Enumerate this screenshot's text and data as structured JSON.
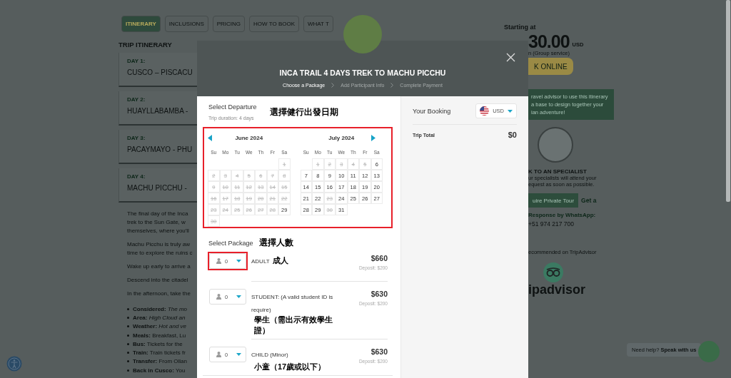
{
  "page": {
    "tabs": [
      {
        "label": "ITINERARY",
        "selected": true
      },
      {
        "label": "INCLUSIONS",
        "selected": false
      },
      {
        "label": "PRICING",
        "selected": false
      },
      {
        "label": "HOW TO BOOK",
        "selected": false
      },
      {
        "label": "WHAT T",
        "selected": false
      }
    ],
    "section_title": "TRIP ITINERARY",
    "days": [
      {
        "label": "DAY 1:",
        "title": "CUSCO – PISCACU"
      },
      {
        "label": "DAY 2:",
        "title": "HUAYLLABAMBA -"
      },
      {
        "label": "DAY 3:",
        "title": "PACAYMAYO - PHU"
      },
      {
        "label": "DAY 4:",
        "title": "MACHU PICCHU -"
      }
    ],
    "paragraphs": [
      [
        "The final day of the Inca",
        "trek to the Sun Gate, w",
        "themselves, where you'll"
      ],
      [
        "Machu Picchu is truly aw",
        "time to explore the ruins c"
      ],
      [
        "Wake up early to arrive a"
      ],
      [
        "Descend into the citadel"
      ],
      [
        "In the afternoon, take the"
      ]
    ],
    "bullets": [
      "**Considered:** *The mo*",
      "**Area:** *High Cloud an*",
      "**Weather:** *Hot and ve*",
      "**Meals:** Breakfast, Lu",
      "**Bus:** Tickets for the",
      "**Train:** Train tickets fr",
      "**Transfer:** From Ollan",
      "**Back in Cusco:** You"
    ],
    "sidebar": {
      "starting_label": "Starting at",
      "price": "30.00",
      "currency": "USD",
      "price_note": "n (Group service)",
      "book_button": "K ONLINE",
      "advisor_lines": [
        "ravel advisor to use this itinerary",
        "a base to design together your",
        "ian adventure!"
      ],
      "specialist_title": "K TO AN SPECIALIST",
      "specialist_lines": [
        "ur specialists will attend your",
        "equest as soon as possible."
      ],
      "inquire_button": "uire Private Tour",
      "get_a": "Get a",
      "whatsapp_label": "Response by WhatsApp:",
      "whatsapp_number": "+51 974 217 700",
      "tripadvisor_label": "ecommended on TripAdvisor",
      "tripadvisor_logo": "ipadvisor"
    },
    "help_chip": "Need help? **Speak with us**"
  },
  "modal": {
    "title": "INCA TRAIL 4 DAYS TREK TO MACHU PICCHU",
    "steps": [
      {
        "label": "Choose a Package",
        "selected": true
      },
      {
        "label": "Add Participant Info",
        "selected": false
      },
      {
        "label": "Complete Payment",
        "selected": false
      }
    ],
    "departure": {
      "heading": "Select Departure",
      "duration": "Trip duration: 4 days",
      "annotation": "選擇健行出發日期",
      "highlighted": true,
      "months": [
        {
          "title": "June 2024",
          "kind": "prev",
          "weekdays": [
            "Su",
            "Mo",
            "Tu",
            "We",
            "Th",
            "Fr",
            "Sa"
          ],
          "weeks": [
            [
              {
                "day": "1",
                "disabled": true
              }
            ],
            [
              {
                "day": "2",
                "disabled": true
              },
              {
                "day": "3",
                "disabled": true
              },
              {
                "day": "4",
                "disabled": true
              },
              {
                "day": "5",
                "disabled": true
              },
              {
                "day": "6",
                "disabled": true
              },
              {
                "day": "7",
                "disabled": true
              },
              {
                "day": "8",
                "disabled": true
              }
            ],
            [
              {
                "day": "9",
                "disabled": true
              },
              {
                "day": "10",
                "disabled": true
              },
              {
                "day": "11",
                "disabled": true
              },
              {
                "day": "12",
                "disabled": true
              },
              {
                "day": "13",
                "disabled": true
              },
              {
                "day": "14",
                "disabled": true
              },
              {
                "day": "15",
                "disabled": true
              }
            ],
            [
              {
                "day": "16",
                "disabled": true
              },
              {
                "day": "17",
                "disabled": true
              },
              {
                "day": "18",
                "disabled": true
              },
              {
                "day": "19",
                "disabled": true
              },
              {
                "day": "20",
                "disabled": true
              },
              {
                "day": "21",
                "disabled": true
              },
              {
                "day": "22",
                "disabled": true
              }
            ],
            [
              {
                "day": "23",
                "disabled": true
              },
              {
                "day": "24",
                "disabled": true
              },
              {
                "day": "25",
                "disabled": true
              },
              {
                "day": "26",
                "disabled": true
              },
              {
                "day": "27",
                "disabled": true
              },
              {
                "day": "28",
                "disabled": true
              },
              {
                "day": "29",
                "disabled": false
              }
            ],
            [
              {
                "day": "30",
                "disabled": true
              }
            ]
          ]
        },
        {
          "title": "July 2024",
          "kind": "next",
          "weekdays": [
            "Su",
            "Mo",
            "Tu",
            "We",
            "Th",
            "Fr",
            "Sa"
          ],
          "weeks": [
            [
              {
                "day": "1",
                "disabled": true
              },
              {
                "day": "2",
                "disabled": true
              },
              {
                "day": "3",
                "disabled": true
              },
              {
                "day": "4",
                "disabled": true
              },
              {
                "day": "5",
                "disabled": true
              },
              {
                "day": "6",
                "disabled": false
              }
            ],
            [
              {
                "day": "7",
                "disabled": false
              },
              {
                "day": "8",
                "disabled": false
              },
              {
                "day": "9",
                "disabled": false
              },
              {
                "day": "10",
                "disabled": false
              },
              {
                "day": "11",
                "disabled": false
              },
              {
                "day": "12",
                "disabled": false
              },
              {
                "day": "13",
                "disabled": false
              }
            ],
            [
              {
                "day": "14",
                "disabled": false
              },
              {
                "day": "15",
                "disabled": false
              },
              {
                "day": "16",
                "disabled": false
              },
              {
                "day": "17",
                "disabled": false
              },
              {
                "day": "18",
                "disabled": false
              },
              {
                "day": "19",
                "disabled": false
              },
              {
                "day": "20",
                "disabled": false
              }
            ],
            [
              {
                "day": "21",
                "disabled": false
              },
              {
                "day": "22",
                "disabled": false
              },
              {
                "day": "23",
                "disabled": true
              },
              {
                "day": "24",
                "disabled": false
              },
              {
                "day": "25",
                "disabled": false
              },
              {
                "day": "26",
                "disabled": false
              },
              {
                "day": "27",
                "disabled": false
              }
            ],
            [
              {
                "day": "28",
                "disabled": false
              },
              {
                "day": "29",
                "disabled": false
              },
              {
                "day": "30",
                "disabled": true
              },
              {
                "day": "31",
                "disabled": false
              }
            ]
          ]
        }
      ]
    },
    "package": {
      "heading": "Select Package",
      "annotation": "選擇人數",
      "items": [
        {
          "label": "ADULT",
          "note": "成人",
          "count": "0",
          "price": "$660",
          "deposit": "Deposit: $200",
          "highlighted": true
        },
        {
          "label": "STUDENT: (A valid student ID is require)",
          "note": "學生（需出示有效學生證）",
          "count": "0",
          "price": "$630",
          "deposit": "Deposit: $200",
          "highlighted": false
        },
        {
          "label": "CHILD (Minor)",
          "note": "小童（17歲或以下）",
          "count": "0",
          "price": "$630",
          "deposit": "Deposit: $200",
          "highlighted": false
        }
      ]
    },
    "booking": {
      "heading": "Your Booking",
      "currency": "USD",
      "total_label": "Trip Total",
      "total": "$0"
    }
  }
}
